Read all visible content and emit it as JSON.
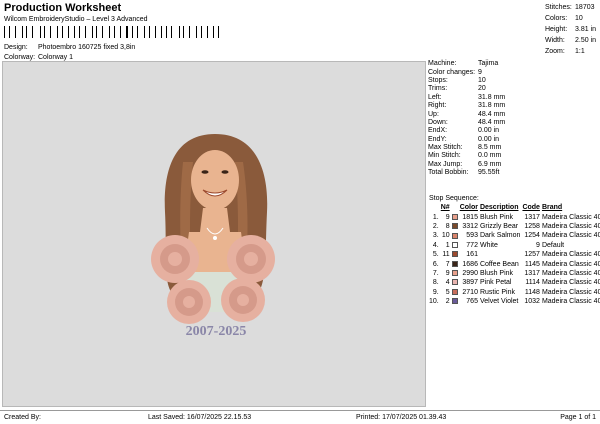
{
  "header": {
    "title": "Production Worksheet",
    "subtitle": "Wilcom EmbroideryStudio – Level 3 Advanced",
    "stats": [
      {
        "label": "Stitches:",
        "value": "18703"
      },
      {
        "label": "Colors:",
        "value": "10"
      },
      {
        "label": "Height:",
        "value": "3.81 in"
      },
      {
        "label": "Width:",
        "value": "2.50 in"
      },
      {
        "label": "Zoom:",
        "value": "1:1"
      }
    ]
  },
  "meta": {
    "design_label": "Design:",
    "design_value": "Photoembro 160725 fixed 3,8in",
    "colorway_label": "Colorway:",
    "colorway_value": "Colorway 1"
  },
  "design": {
    "caption": "2007-2025",
    "colors": {
      "background": "#dcdcdc",
      "hair": "#8a5a3b",
      "hair_light": "#a8704c",
      "skin": "#e9b490",
      "rose": "#e6b0a0",
      "rose_dark": "#c98c7c",
      "caption": "#8a86a8",
      "shirt": "#d9e1d6"
    }
  },
  "machine_info": [
    {
      "label": "Machine:",
      "value": "Tajima"
    },
    {
      "label": "Color changes:",
      "value": "9"
    },
    {
      "label": "Stops:",
      "value": "10"
    },
    {
      "label": "Trims:",
      "value": "20"
    },
    {
      "label": "Left:",
      "value": "31.8 mm"
    },
    {
      "label": "Right:",
      "value": "31.8 mm"
    },
    {
      "label": "Up:",
      "value": "48.4 mm"
    },
    {
      "label": "Down:",
      "value": "48.4 mm"
    },
    {
      "label": "EndX:",
      "value": "0.00 in"
    },
    {
      "label": "EndY:",
      "value": "0.00 in"
    },
    {
      "label": "Max Stitch:",
      "value": "8.5 mm"
    },
    {
      "label": "Min Stitch:",
      "value": "0.0 mm"
    },
    {
      "label": "Max Jump:",
      "value": "6.9 mm"
    },
    {
      "label": "Total Bobbin:",
      "value": "95.55ft"
    }
  ],
  "stop_sequence": {
    "title": "Stop Sequence:",
    "headers": {
      "n": "N#",
      "color": "Color",
      "description": "Description",
      "code": "Code",
      "brand": "Brand"
    },
    "rows": [
      {
        "stop": "1.",
        "n": "9",
        "swatch": "#e8a08c",
        "color": "1815",
        "description": "Blush Pink",
        "code": "1317",
        "brand": "Madeira Classic 40"
      },
      {
        "stop": "2.",
        "n": "8",
        "swatch": "#7a4a2a",
        "color": "3312",
        "description": "Grizzly Bear",
        "code": "1258",
        "brand": "Madeira Classic 40"
      },
      {
        "stop": "3.",
        "n": "10",
        "swatch": "#d9846b",
        "color": "593",
        "description": "Dark Salmon",
        "code": "1254",
        "brand": "Madeira Classic 40"
      },
      {
        "stop": "4.",
        "n": "1",
        "swatch": "#ffffff",
        "color": "772",
        "description": "White",
        "code": "9",
        "brand": "Default"
      },
      {
        "stop": "5.",
        "n": "11",
        "swatch": "#9c4a2e",
        "color": "161",
        "description": "",
        "code": "1257",
        "brand": "Madeira Classic 40"
      },
      {
        "stop": "6.",
        "n": "7",
        "swatch": "#3a2418",
        "color": "1686",
        "description": "Coffee Bean",
        "code": "1145",
        "brand": "Madeira Classic 40"
      },
      {
        "stop": "7.",
        "n": "9",
        "swatch": "#e8a08c",
        "color": "2990",
        "description": "Blush Pink",
        "code": "1317",
        "brand": "Madeira Classic 40"
      },
      {
        "stop": "8.",
        "n": "4",
        "swatch": "#e8b4b0",
        "color": "3897",
        "description": "Pink Petal",
        "code": "1114",
        "brand": "Madeira Classic 40"
      },
      {
        "stop": "9.",
        "n": "5",
        "swatch": "#c86e5c",
        "color": "2710",
        "description": "Rustic Pink",
        "code": "1148",
        "brand": "Madeira Classic 40"
      },
      {
        "stop": "10.",
        "n": "2",
        "swatch": "#6a5a9a",
        "color": "765",
        "description": "Velvet Violet",
        "code": "1032",
        "brand": "Madeira Classic 40"
      }
    ]
  },
  "footer": {
    "created_by": "Created By:",
    "last_saved": "Last Saved: 16/07/2025 22.15.53",
    "printed": "Printed: 17/07/2025 01.39.43",
    "page": "Page 1 of 1"
  }
}
